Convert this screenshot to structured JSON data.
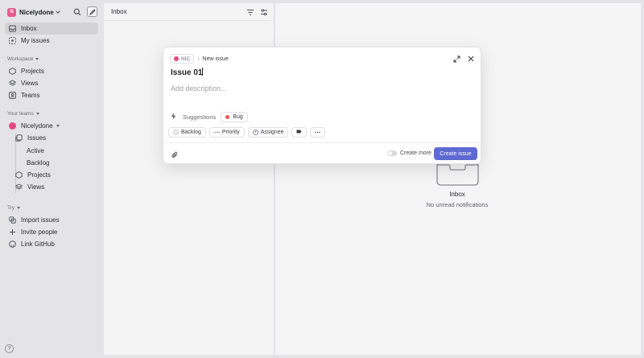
{
  "workspace": {
    "logo_letter": "N",
    "name": "Nicelydone"
  },
  "sidebar": {
    "items": [
      {
        "label": "Inbox",
        "icon": "inbox-icon"
      },
      {
        "label": "My issues",
        "icon": "target-icon"
      }
    ],
    "workspace_section": {
      "header": "Workspace",
      "items": [
        {
          "label": "Projects",
          "icon": "projects-icon"
        },
        {
          "label": "Views",
          "icon": "layers-icon"
        },
        {
          "label": "Teams",
          "icon": "teams-icon"
        }
      ]
    },
    "teams_section": {
      "header": "Your teams",
      "team": "Nicelydone",
      "items": [
        {
          "label": "Issues",
          "icon": "issues-icon"
        },
        {
          "label": "Active"
        },
        {
          "label": "Backlog"
        },
        {
          "label": "Projects",
          "icon": "projects-icon"
        },
        {
          "label": "Views",
          "icon": "layers-icon"
        }
      ]
    },
    "try_section": {
      "header": "Try",
      "items": [
        {
          "label": "Import issues",
          "icon": "import-icon"
        },
        {
          "label": "Invite people",
          "icon": "plus-icon"
        },
        {
          "label": "Link GitHub",
          "icon": "github-icon"
        }
      ]
    },
    "help": "?"
  },
  "inbox": {
    "title": "Inbox"
  },
  "empty_state": {
    "title": "Inbox",
    "subtitle": "No unread notifications"
  },
  "modal": {
    "team_chip": "NIC",
    "breadcrumb": "New issue",
    "title_value": "Issue 01",
    "description_placeholder": "Add description...",
    "suggestions_label": "Suggestions",
    "suggestion_bug": "Bug",
    "status": "Backlog",
    "priority": "Priority",
    "assignee": "Assignee",
    "create_more_label": "Create more",
    "create_button": "Create issue"
  },
  "colors": {
    "accent": "#5e6ad2",
    "team": "#e8487f",
    "bug": "#eb5757"
  }
}
